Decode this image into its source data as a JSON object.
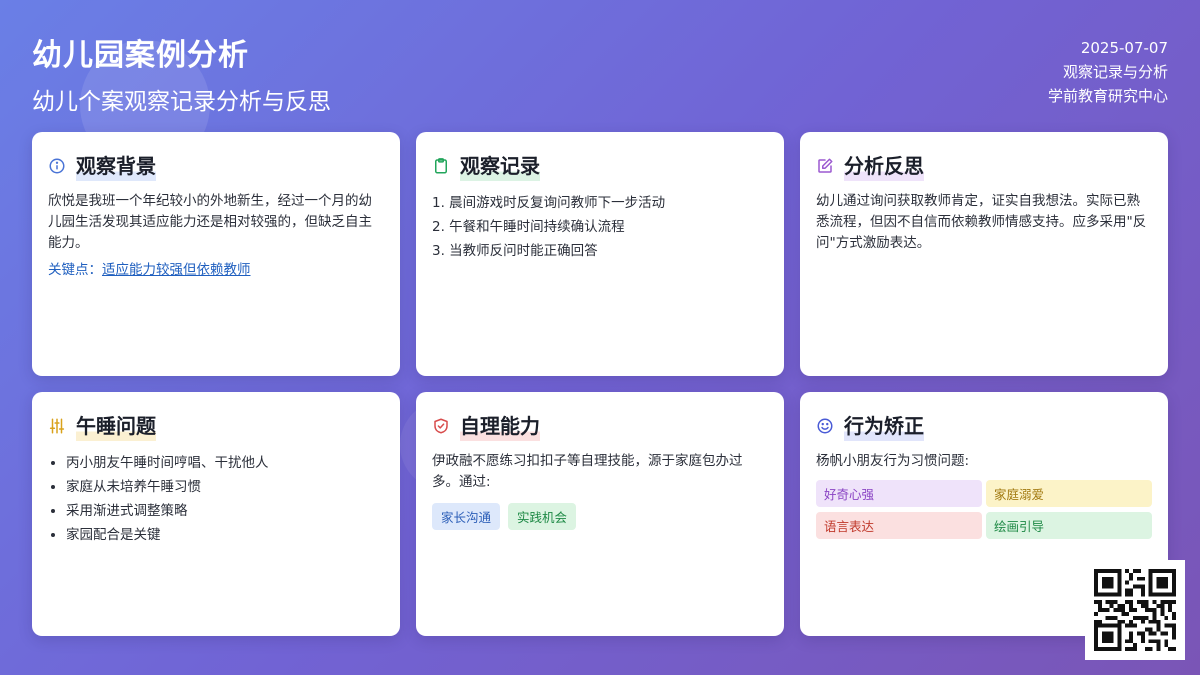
{
  "header": {
    "title": "幼儿园案例分析",
    "subtitle": "幼儿个案观察记录分析与反思",
    "date": "2025-07-07",
    "meta_line": "观察记录与分析",
    "organization": "学前教育研究中心"
  },
  "cards": {
    "background": {
      "icon": "info-icon",
      "title": "观察背景",
      "text": "欣悦是我班一个年纪较小的外地新生，经过一个月的幼儿园生活发现其适应能力还是相对较强的，但缺乏自主能力。",
      "key_label": "关键点：",
      "key_link": "适应能力较强但依赖教师"
    },
    "records": {
      "icon": "clipboard-icon",
      "title": "观察记录",
      "items": [
        "1. 晨间游戏时反复询问教师下一步活动",
        "2. 午餐和午睡时间持续确认流程",
        "3. 当教师反问时能正确回答"
      ]
    },
    "reflection": {
      "icon": "edit-icon",
      "title": "分析反思",
      "text": "幼儿通过询问获取教师肯定，证实自我想法。实际已熟悉流程，但因不自信而依赖教师情感支持。应多采用\"反问\"方式激励表达。"
    },
    "nap": {
      "icon": "sliders-icon",
      "title": "午睡问题",
      "items": [
        "丙小朋友午睡时间哼唱、干扰他人",
        "家庭从未培养午睡习惯",
        "采用渐进式调整策略",
        "家园配合是关键"
      ]
    },
    "selfcare": {
      "icon": "shield-check-icon",
      "title": "自理能力",
      "text": "伊政融不愿练习扣扣子等自理技能，源于家庭包办过多。通过:",
      "tags": [
        "家长沟通",
        "实践机会"
      ]
    },
    "behavior": {
      "icon": "smile-icon",
      "title": "行为矫正",
      "text": "杨帆小朋友行为习惯问题:",
      "tags": [
        "好奇心强",
        "家庭溺爱",
        "语言表达",
        "绘画引导"
      ]
    }
  },
  "colors": {
    "info": "#4a74d6",
    "clipboard": "#22a55b",
    "edit": "#9b59d0",
    "sliders": "#d9a21b",
    "shield": "#d84c4c",
    "smile": "#4a5bd6"
  },
  "qr_code": {
    "icon": "qr-code-icon"
  }
}
